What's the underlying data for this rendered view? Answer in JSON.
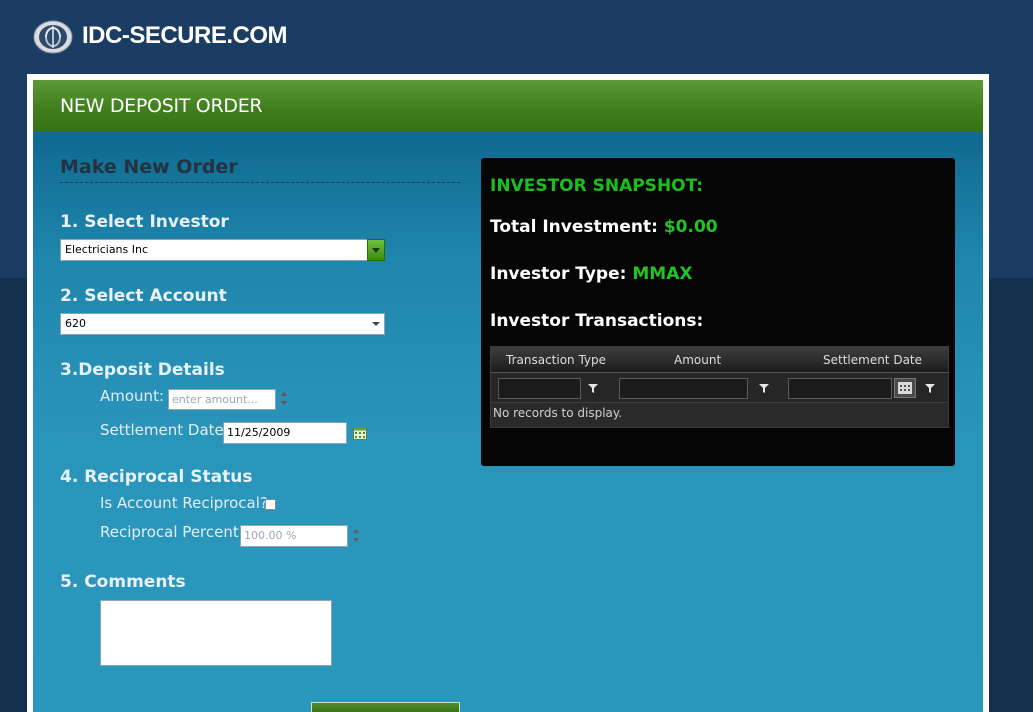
{
  "site": {
    "name": "IDC-SECURE.COM"
  },
  "panel": {
    "title": "NEW DEPOSIT ORDER"
  },
  "form": {
    "title": "Make New Order",
    "step1": {
      "label": "1. Select Investor",
      "value": "Electricians Inc"
    },
    "step2": {
      "label": "2. Select Account",
      "value": "620"
    },
    "step3": {
      "label": "3.Deposit Details",
      "amount_label": "Amount:",
      "amount_placeholder": "enter amount...",
      "settlement_label": "Settlement Date:",
      "settlement_value": "11/25/2009"
    },
    "step4": {
      "label": "4. Reciprocal Status",
      "reciprocal_label": "Is Account Reciprocal?",
      "reciprocal_checked": false,
      "percent_label": "Reciprocal Percent:",
      "percent_value": "100.00 %"
    },
    "step5": {
      "label": "5. Comments",
      "value": ""
    }
  },
  "snapshot": {
    "title": "INVESTOR SNAPSHOT:",
    "total_label": "Total Investment:",
    "total_value": "$0.00",
    "type_label": "Investor Type:",
    "type_value": "MMAX",
    "transactions_label": "Investor Transactions:",
    "grid": {
      "columns": [
        "Transaction Type",
        "Amount",
        "Settlement Date"
      ],
      "empty_text": "No records to display."
    }
  },
  "colors": {
    "header_green": "#3f7d1c",
    "accent_value_green": "#22c322",
    "page_bg": "#1b3d63"
  },
  "icons": [
    "globe-logo-icon",
    "chevron-down-icon",
    "calendar-icon",
    "spinner-icon",
    "funnel-filter-icon"
  ]
}
